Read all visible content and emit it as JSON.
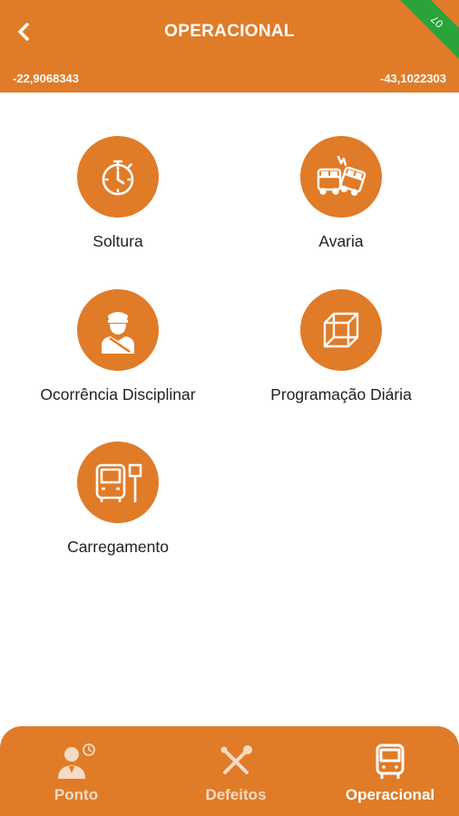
{
  "header": {
    "title": "OPERACIONAL",
    "latitude": "-22,9068343",
    "longitude": "-43,1022303",
    "corner_badge": "07"
  },
  "menu": [
    {
      "label": "Soltura",
      "icon": "stopwatch-icon"
    },
    {
      "label": "Avaria",
      "icon": "bus-collision-icon"
    },
    {
      "label": "Ocorrência Disciplinar",
      "icon": "driver-icon"
    },
    {
      "label": "Programação Diária",
      "icon": "cube-icon"
    },
    {
      "label": "Carregamento",
      "icon": "bus-stop-icon"
    }
  ],
  "bottom_nav": [
    {
      "label": "Ponto",
      "icon": "user-clock-icon",
      "active": false
    },
    {
      "label": "Defeitos",
      "icon": "tools-icon",
      "active": false
    },
    {
      "label": "Operacional",
      "icon": "bus-icon",
      "active": true
    }
  ],
  "colors": {
    "primary": "#e07b28",
    "badge": "#2aa33a",
    "text": "#222222",
    "inactive_nav_text": "#f6dbc2"
  }
}
